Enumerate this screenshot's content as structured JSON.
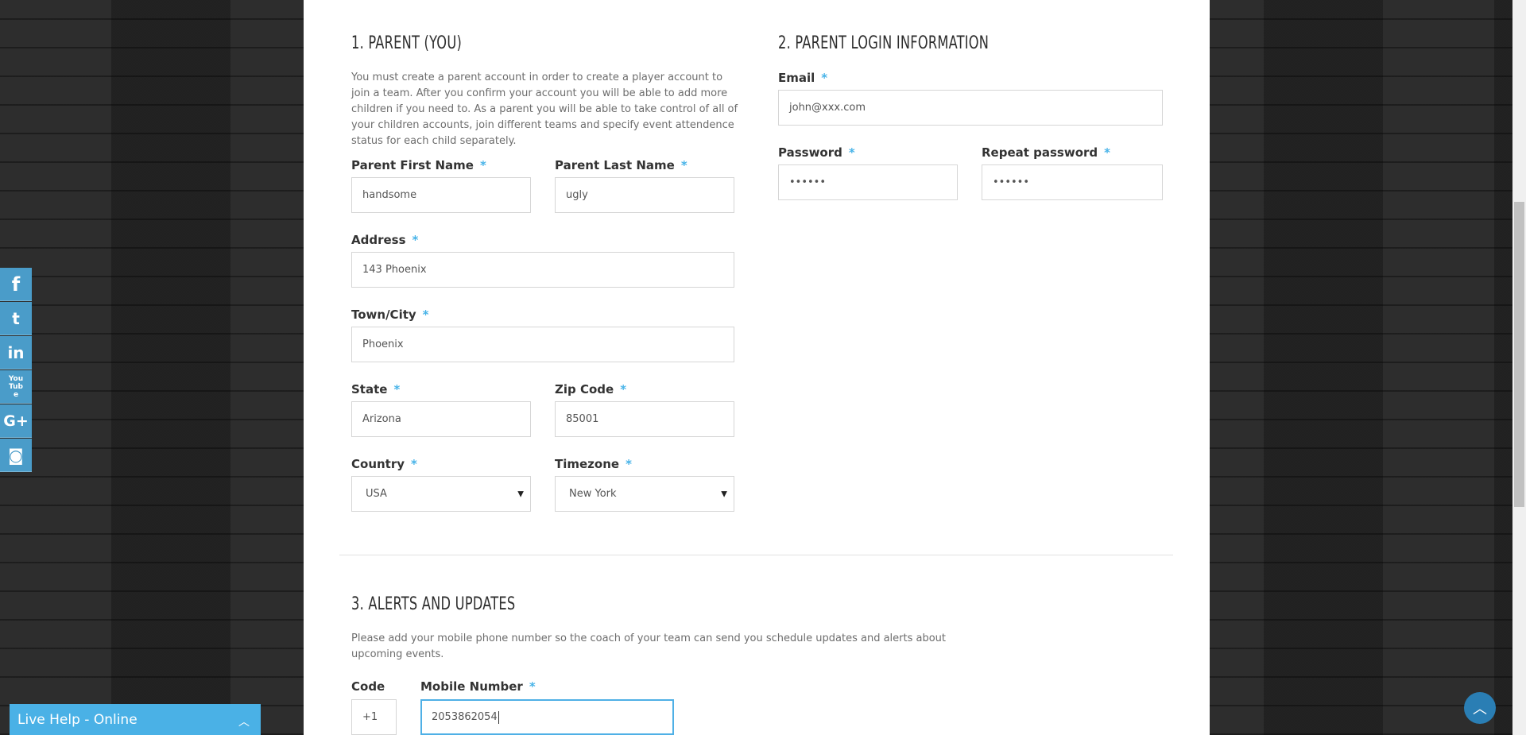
{
  "section1": {
    "title": "1. PARENT (YOU)",
    "description": "You must create a parent account in order to create a player account to join a team. After you confirm your account you will be able to add more children if you need to. As a parent you will be able to take control of all of your children accounts, join different teams and specify event attendence status for each child separately.",
    "first_name": {
      "label": "Parent First Name",
      "value": "handsome"
    },
    "last_name": {
      "label": "Parent Last Name",
      "value": "ugly"
    },
    "address": {
      "label": "Address",
      "value": "143 Phoenix"
    },
    "city": {
      "label": "Town/City",
      "value": "Phoenix"
    },
    "state": {
      "label": "State",
      "value": "Arizona"
    },
    "zip": {
      "label": "Zip Code",
      "value": "85001"
    },
    "country": {
      "label": "Country",
      "value": "USA"
    },
    "timezone": {
      "label": "Timezone",
      "value": "New York"
    }
  },
  "section2": {
    "title": "2. PARENT LOGIN INFORMATION",
    "email": {
      "label": "Email",
      "value": "john@xxx.com"
    },
    "password": {
      "label": "Password",
      "value": "••••••"
    },
    "repeat_password": {
      "label": "Repeat password",
      "value": "••••••"
    }
  },
  "section3": {
    "title": "3. ALERTS AND UPDATES",
    "description": "Please add your mobile phone number so the coach of your team can send you schedule updates and alerts about upcoming events.",
    "code": {
      "label": "Code",
      "value": "+1"
    },
    "mobile": {
      "label": "Mobile Number",
      "value": "2053862054"
    }
  },
  "required_mark": "*",
  "social": [
    {
      "icon": "facebook-icon",
      "glyph": "f"
    },
    {
      "icon": "twitter-icon",
      "glyph": "t"
    },
    {
      "icon": "linkedin-icon",
      "glyph": "in"
    },
    {
      "icon": "youtube-icon",
      "glyph": "You Tube"
    },
    {
      "icon": "google-plus-icon",
      "glyph": "G+"
    },
    {
      "icon": "instagram-icon",
      "glyph": "◙"
    }
  ],
  "live_help": {
    "label": "Live Help - Online",
    "chevron": "︿"
  },
  "to_top": {
    "glyph": "︿"
  },
  "select_caret": "▼"
}
